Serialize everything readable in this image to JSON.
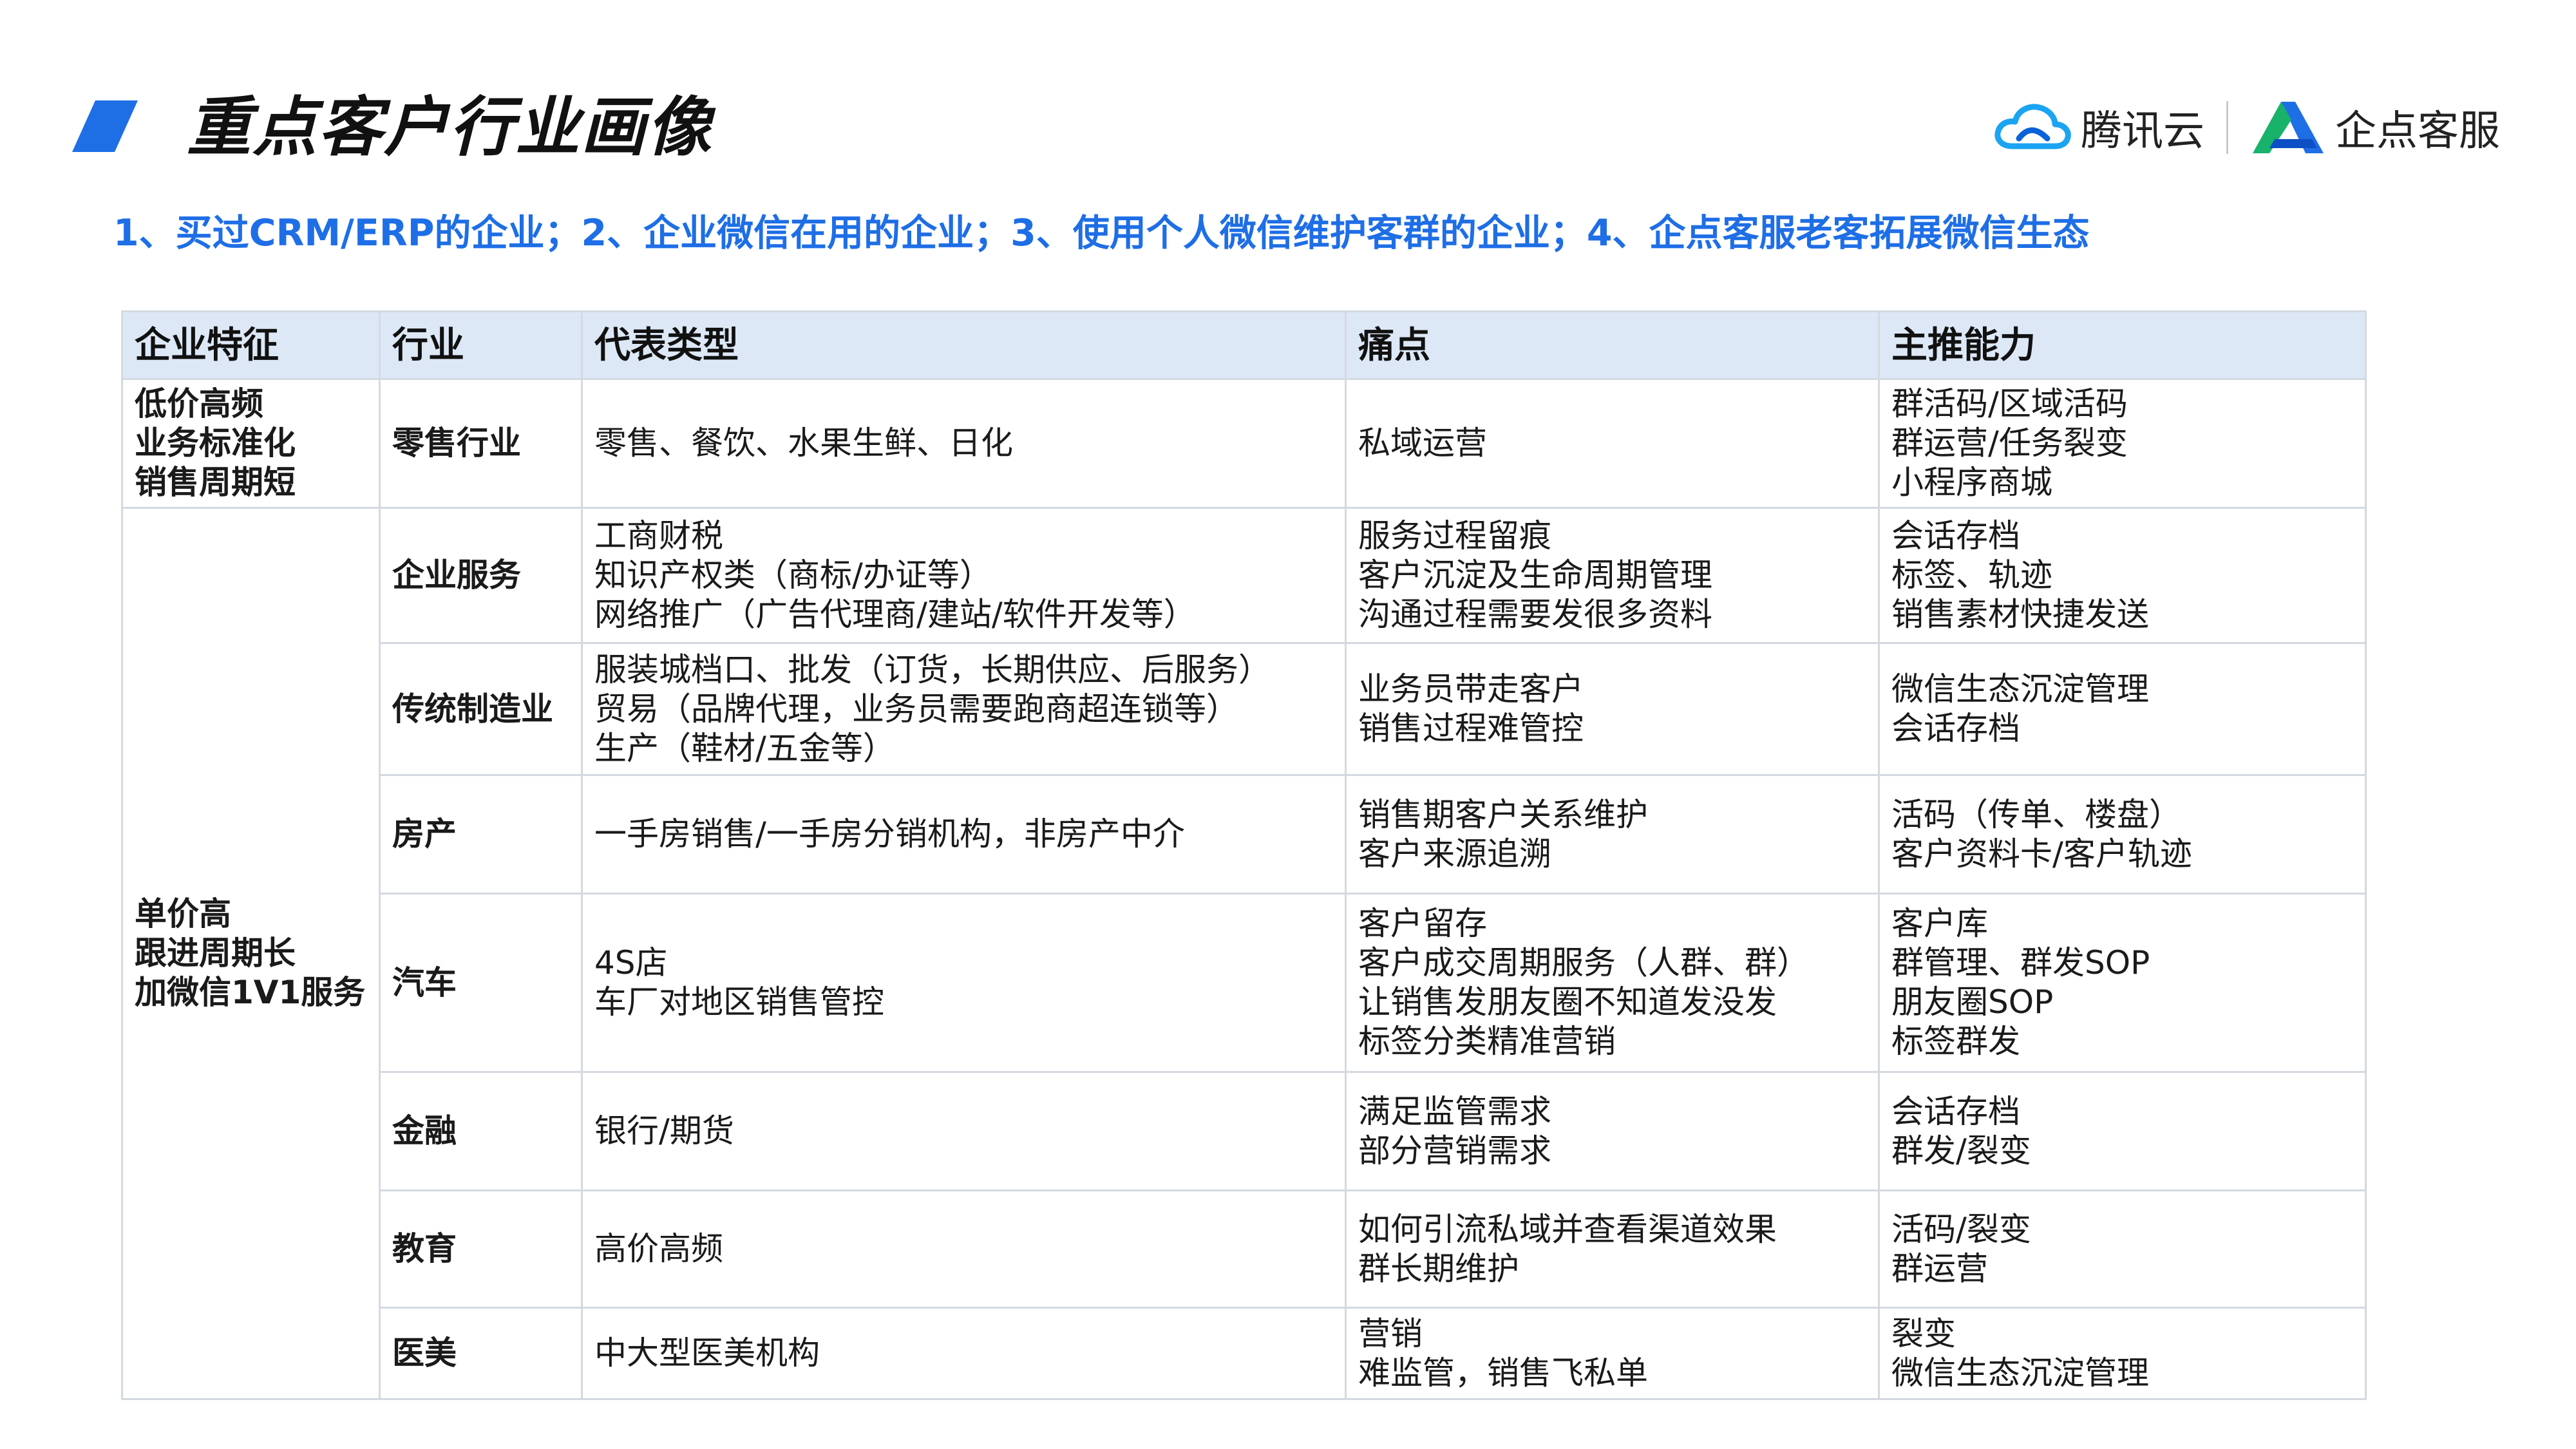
{
  "header": {
    "title": "重点客户行业画像",
    "subtitle": "1、买过CRM/ERP的企业；2、企业微信在用的企业；3、使用个人微信维护客群的企业；4、企点客服老客拓展微信生态",
    "logos": {
      "tencent_cloud": "腾讯云",
      "qidian": "企点客服"
    }
  },
  "colors": {
    "accent_blue": "#1e6ee6",
    "header_bg": "#dde8f6",
    "border": "#d4d9e0"
  },
  "table": {
    "headers": [
      "企业特征",
      "行业",
      "代表类型",
      "痛点",
      "主推能力"
    ],
    "groups": [
      {
        "feature": [
          "低价高频",
          "业务标准化",
          "销售周期短"
        ]
      },
      {
        "feature": [
          "单价高",
          "跟进周期长",
          "加微信1V1服务"
        ]
      }
    ],
    "rows": [
      {
        "industry": "零售行业",
        "types": [
          "零售、餐饮、水果生鲜、日化"
        ],
        "pain": [
          "私域运营"
        ],
        "capability": [
          "群活码/区域活码",
          "群运营/任务裂变",
          "小程序商城"
        ]
      },
      {
        "industry": "企业服务",
        "types": [
          "工商财税",
          "知识产权类（商标/办证等）",
          "网络推广（广告代理商/建站/软件开发等）"
        ],
        "pain": [
          "服务过程留痕",
          "客户沉淀及生命周期管理",
          "沟通过程需要发很多资料"
        ],
        "capability": [
          "会话存档",
          "标签、轨迹",
          "销售素材快捷发送"
        ]
      },
      {
        "industry": "传统制造业",
        "types": [
          "服装城档口、批发（订货，长期供应、后服务）",
          "贸易（品牌代理，业务员需要跑商超连锁等）",
          "生产（鞋材/五金等）"
        ],
        "pain": [
          "业务员带走客户",
          "销售过程难管控"
        ],
        "capability": [
          "微信生态沉淀管理",
          "会话存档"
        ]
      },
      {
        "industry": "房产",
        "types": [
          "一手房销售/一手房分销机构，非房产中介"
        ],
        "pain": [
          "销售期客户关系维护",
          "客户来源追溯"
        ],
        "capability": [
          "活码（传单、楼盘）",
          "客户资料卡/客户轨迹"
        ]
      },
      {
        "industry": "汽车",
        "types": [
          "4S店",
          "车厂对地区销售管控"
        ],
        "pain": [
          "客户留存",
          "客户成交周期服务（人群、群）",
          "让销售发朋友圈不知道发没发",
          "标签分类精准营销"
        ],
        "capability": [
          "客户库",
          "群管理、群发SOP",
          "朋友圈SOP",
          "标签群发"
        ]
      },
      {
        "industry": "金融",
        "types": [
          "银行/期货"
        ],
        "pain": [
          "满足监管需求",
          "部分营销需求"
        ],
        "capability": [
          "会话存档",
          "群发/裂变"
        ]
      },
      {
        "industry": "教育",
        "types": [
          "高价高频"
        ],
        "pain": [
          "如何引流私域并查看渠道效果",
          "群长期维护"
        ],
        "capability": [
          "活码/裂变",
          "群运营"
        ]
      },
      {
        "industry": "医美",
        "types": [
          "中大型医美机构"
        ],
        "pain": [
          "营销",
          "难监管，销售飞私单"
        ],
        "capability": [
          "裂变",
          "微信生态沉淀管理"
        ]
      }
    ]
  }
}
